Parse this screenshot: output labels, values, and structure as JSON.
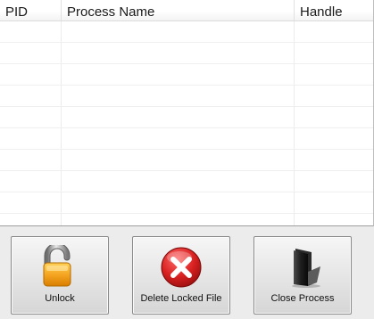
{
  "table": {
    "columns": [
      {
        "key": "pid",
        "label": "PID"
      },
      {
        "key": "process_name",
        "label": "Process Name"
      },
      {
        "key": "handle",
        "label": "Handle"
      }
    ],
    "rows": []
  },
  "buttons": {
    "unlock": {
      "label": "Unlock",
      "icon": "padlock-open-icon"
    },
    "delete_locked_file": {
      "label": "Delete Locked File",
      "icon": "red-x-icon"
    },
    "close_process": {
      "label": "Close Process",
      "icon": "black-folder-icon"
    }
  },
  "colors": {
    "window_bg": "#ececec",
    "list_bg": "#ffffff",
    "gridline": "#efefef",
    "padlock_body": "#f2a21a",
    "delete_red": "#d21f1f",
    "folder_black": "#1e1e1e"
  }
}
